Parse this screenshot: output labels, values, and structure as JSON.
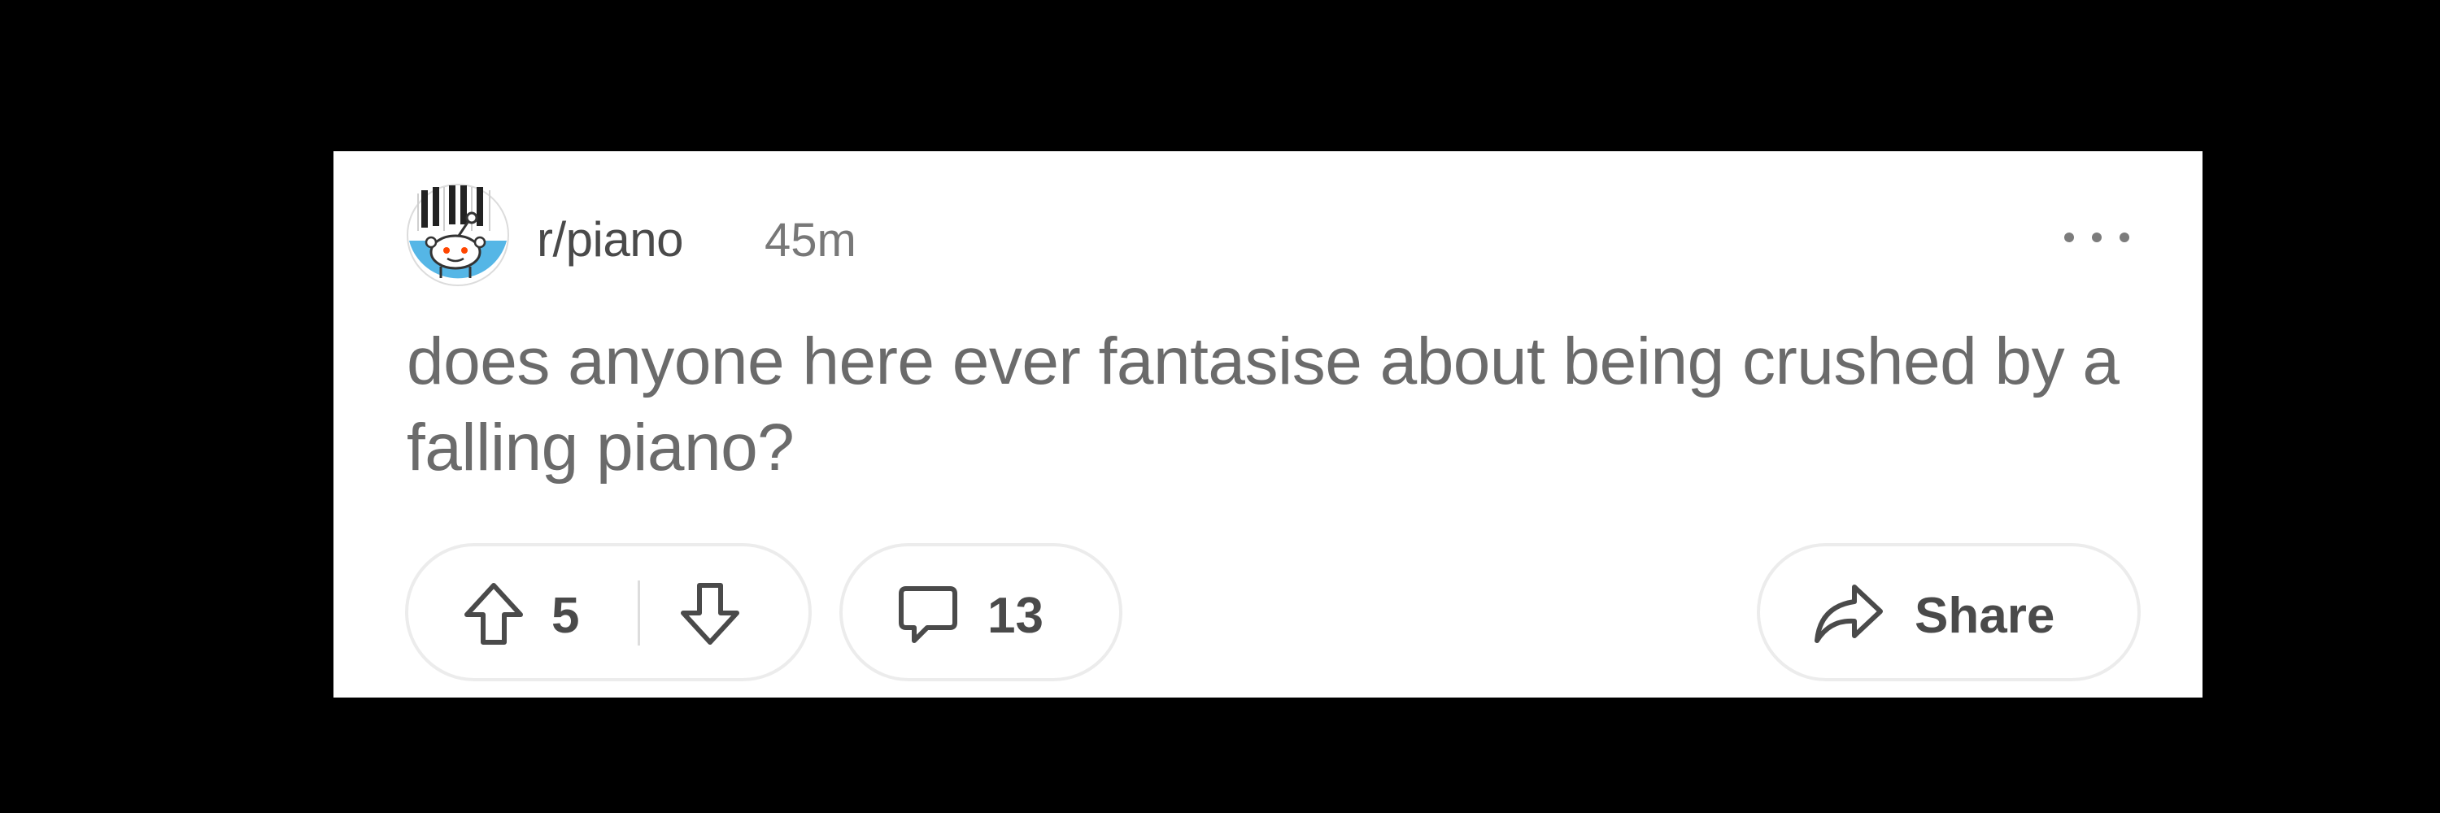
{
  "post": {
    "subreddit": "r/piano",
    "time": "45m",
    "title": "does anyone here ever fantasise about being crushed by a falling piano?"
  },
  "actions": {
    "score": "5",
    "comments": "13",
    "share_label": "Share"
  },
  "icons": {
    "avatar": "subreddit-piano-snoo-avatar",
    "more": "more-options-icon",
    "upvote": "upvote-arrow-icon",
    "downvote": "downvote-arrow-icon",
    "comment": "comment-bubble-icon",
    "share": "share-arrow-icon"
  },
  "colors": {
    "page_background": "#000000",
    "card_background": "#ffffff",
    "avatar_blue": "#55b6e6",
    "text": "#4a4a4a",
    "muted": "#787878"
  }
}
